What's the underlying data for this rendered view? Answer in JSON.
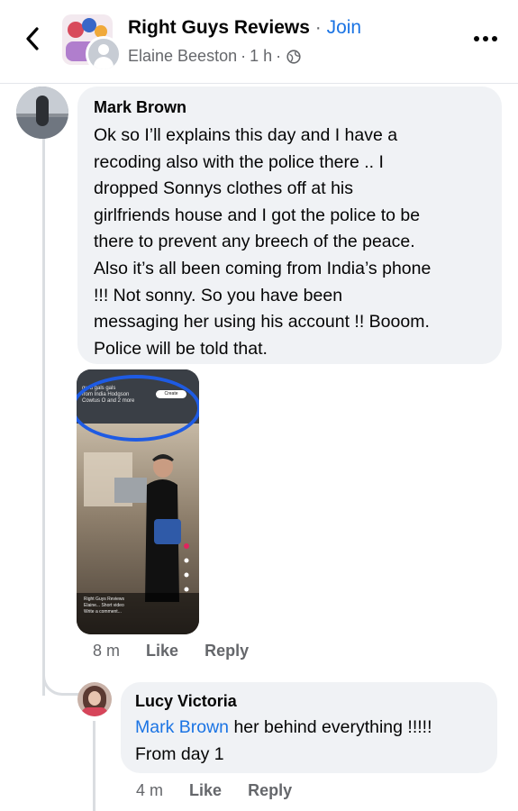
{
  "header": {
    "group_name": "Right Guys Reviews",
    "separator": "·",
    "join_label": "Join",
    "poster_name": "Elaine Beeston",
    "time": "1 h",
    "sub_sep": "·"
  },
  "comments": [
    {
      "author": "Mark Brown",
      "lines": [
        "Ok so I’ll explains  this day and I have a",
        "recoding also with the police there .. I",
        "dropped Sonnys clothes off at his",
        "girlfriends house and I got the police to be",
        "there to prevent any breech of the peace.",
        "Also it’s all been coming from India’s phone",
        "!!! Not sonny.  So you have been",
        "messaging her using his account !! Booom.",
        "Police will be told that."
      ],
      "attachment": {
        "thumb_text_1": "guru gals gals",
        "thumb_text_2": "from India Hodgson",
        "thumb_text_3": "Cowtus O and 2 more",
        "create_label": "Create",
        "bottom_text_1": "Right Guys Reviews",
        "bottom_text_2": "Elaine...  Short video",
        "bottom_text_3": "Write a comment..."
      },
      "time": "8 m",
      "like_label": "Like",
      "reply_label": "Reply"
    },
    {
      "author": "Lucy Victoria",
      "mention": "Mark Brown",
      "text_line_1": " her behind everything !!!!!",
      "text_line_2": "From day 1",
      "time": "4 m",
      "like_label": "Like",
      "reply_label": "Reply"
    }
  ],
  "colors": {
    "link": "#1b74e4",
    "bubble": "#f0f2f5",
    "secondary_text": "#65676b"
  }
}
